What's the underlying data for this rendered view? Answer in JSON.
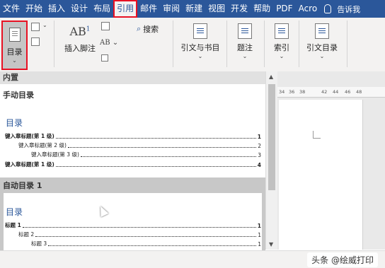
{
  "tabs": [
    {
      "label": "文件",
      "active": false
    },
    {
      "label": "开始",
      "active": false
    },
    {
      "label": "插入",
      "active": false
    },
    {
      "label": "设计",
      "active": false
    },
    {
      "label": "布局",
      "active": false
    },
    {
      "label": "引用",
      "active": true
    },
    {
      "label": "邮件",
      "active": false
    },
    {
      "label": "审阅",
      "active": false
    },
    {
      "label": "新建",
      "active": false
    },
    {
      "label": "视图",
      "active": false
    },
    {
      "label": "开发",
      "active": false
    },
    {
      "label": "帮助",
      "active": false
    },
    {
      "label": "PDF",
      "active": false
    },
    {
      "label": "Acro",
      "active": false
    }
  ],
  "tell_me": "告诉我",
  "ribbon": {
    "toc_label": "目录",
    "footnote_label": "插入脚注",
    "search_label": "搜索",
    "citation_label": "引文与书目",
    "caption_label": "题注",
    "index_label": "索引",
    "toa_label": "引文目录",
    "ab_text": "AB",
    "ab_sup": "1",
    "ab2_text": "AB"
  },
  "gallery": {
    "builtin_header": "内置",
    "manual_title": "手动目录",
    "manual_toc_heading": "目录",
    "manual_entries": [
      {
        "text": "键入章标题(第 1 级)",
        "page": "1"
      },
      {
        "text": "键入章标题(第 2 级)",
        "page": "2"
      },
      {
        "text": "键入章标题(第 3 级)",
        "page": "3"
      },
      {
        "text": "键入章标题(第 1 级)",
        "page": "4"
      }
    ],
    "auto_title": "自动目录 1",
    "auto_toc_heading": "目录",
    "auto_entries": [
      {
        "text": "标题 1",
        "page": "1"
      },
      {
        "text": "标题 2",
        "page": "1"
      },
      {
        "text": "标题 3",
        "page": "1"
      }
    ]
  },
  "ruler_ticks": [
    "34",
    "36",
    "38",
    "42",
    "44",
    "46",
    "48"
  ],
  "watermark": "头条 @绘威打印",
  "colors": {
    "accent": "#2b579a",
    "highlight": "#e81123"
  }
}
